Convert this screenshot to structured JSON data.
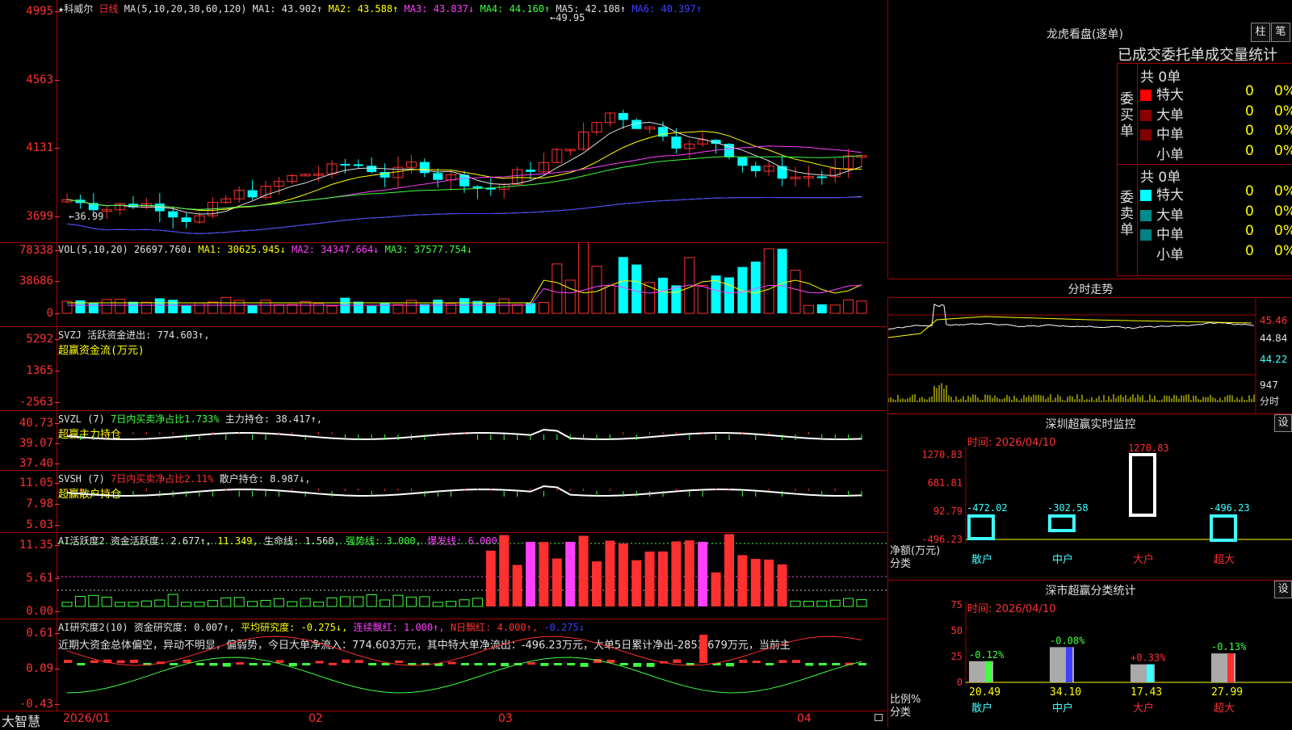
{
  "main": {
    "title": "★科威尔",
    "period": "日线",
    "ma_label": "MA(5,10,20,30,60,120)",
    "ma_values": [
      "MA1: 43.902↑",
      "MA2: 43.588↑",
      "MA3: 43.837↓",
      "MA4: 44.160↑",
      "MA5: 42.108↑",
      "MA6: 40.397↑"
    ],
    "y_ticks": [
      "4995",
      "4563",
      "4131",
      "3699"
    ],
    "high_label": "←49.95",
    "low_label": "←36.99"
  },
  "volume": {
    "label": "VOL(5,10,20)",
    "value": "26697.760↓",
    "mas": [
      "MA1: 30625.945↓",
      "MA2: 34347.664↓",
      "MA3: 37577.754↓"
    ],
    "y_ticks": [
      "78338",
      "38686",
      "0"
    ]
  },
  "svzj": {
    "label": "SVZJ",
    "desc": "活跃资金进出: 774.603↑,",
    "name": "超赢资金流(万元)",
    "y_ticks": [
      "5292",
      "1365",
      "-2563"
    ]
  },
  "svzl": {
    "label": "SVZL (7)",
    "desc1": "7日内买卖净占比1.733%",
    "desc2": "主力持仓: 38.417↑,",
    "name": "超赢主力持仓",
    "y_ticks": [
      "40.73",
      "39.07",
      "37.40"
    ]
  },
  "svsh": {
    "label": "SVSH (7)",
    "desc1": "7日内买卖净占比2.11%",
    "desc2": "散户持仓: 8.987↓,",
    "name": "超赢散户持仓",
    "y_ticks": [
      "11.05",
      "7.98",
      "5.03"
    ]
  },
  "ai_active": {
    "label": "AI活跃度2",
    "desc": "资金活跃度: 2.677↑,",
    "v2": "11.349,",
    "life": "生命线: 1.560,",
    "strong": "强势线: 3.000,",
    "burst": "爆发线: 6.000,",
    "y_ticks": [
      "11.35",
      "5.61",
      "0.00"
    ]
  },
  "ai_research": {
    "label": "AI研究度2(10)",
    "desc": "资金研究度: 0.007↑,",
    "avg": "平均研究度: -0.275↓,",
    "red": "连续飘红: 1.000↑,",
    "nred": "N日飘红: 4.000↑,",
    "tail": "-0.275↓",
    "summary": "近期大资金总体偏空，异动不明显，偏弱势，今日大单净流入：774.603万元，其中特大单净流出：-496.23万元，大单5日累计净出-2853.679万元，当前主",
    "y_ticks": [
      "0.61",
      "0.09",
      "-0.43"
    ]
  },
  "bottom": {
    "brand": "大智慧",
    "dates": [
      "2026/01",
      "02",
      "03",
      "04"
    ]
  },
  "right": {
    "dragon_title": "龙虎看盘(逐单)",
    "btn1": "柱",
    "btn2": "笔",
    "stats_title": "已成交委托单成交量统计",
    "buy_label": "委买单",
    "sell_label": "委卖单",
    "total": "共 0单",
    "rows": [
      {
        "name": "特大",
        "count": "0",
        "pct": "0%"
      },
      {
        "name": "大单",
        "count": "0",
        "pct": "0%"
      },
      {
        "name": "中单",
        "count": "0",
        "pct": "0%"
      },
      {
        "name": "小单",
        "count": "0",
        "pct": "0%"
      }
    ],
    "intraday_title": "分时走势",
    "intraday_ticks": [
      "45.46",
      "44.84",
      "44.22",
      "947"
    ],
    "intraday_bottom": "分时",
    "sz_title": "深圳超赢实时监控",
    "set": "设",
    "time": "时间: 2026/04/10",
    "sz_ticks": [
      "1270.83",
      "681.81",
      "92.79",
      "-496.23"
    ],
    "sz_ylabel": "净额(万元)",
    "sz_xlabel": "分类",
    "cats": [
      "散户",
      "中户",
      "大户",
      "超大"
    ],
    "sz_vals": [
      "-472.02",
      "-302.58",
      "1270.83",
      "-496.23"
    ],
    "cls_title": "深市超赢分类统计",
    "cls_ticks": [
      "75",
      "50",
      "25",
      "0"
    ],
    "cls_ylabel": "比例%",
    "cls_xlabel": "分类",
    "cls_pcts": [
      "20.49",
      "34.10",
      "17.43",
      "27.99"
    ],
    "cls_changes": [
      "-0.12%",
      "-0.08%",
      "+0.33%",
      "-0.13%"
    ]
  },
  "colors": {
    "up": "#ff3030",
    "down": "#00ffff",
    "frame": "#a00000"
  }
}
